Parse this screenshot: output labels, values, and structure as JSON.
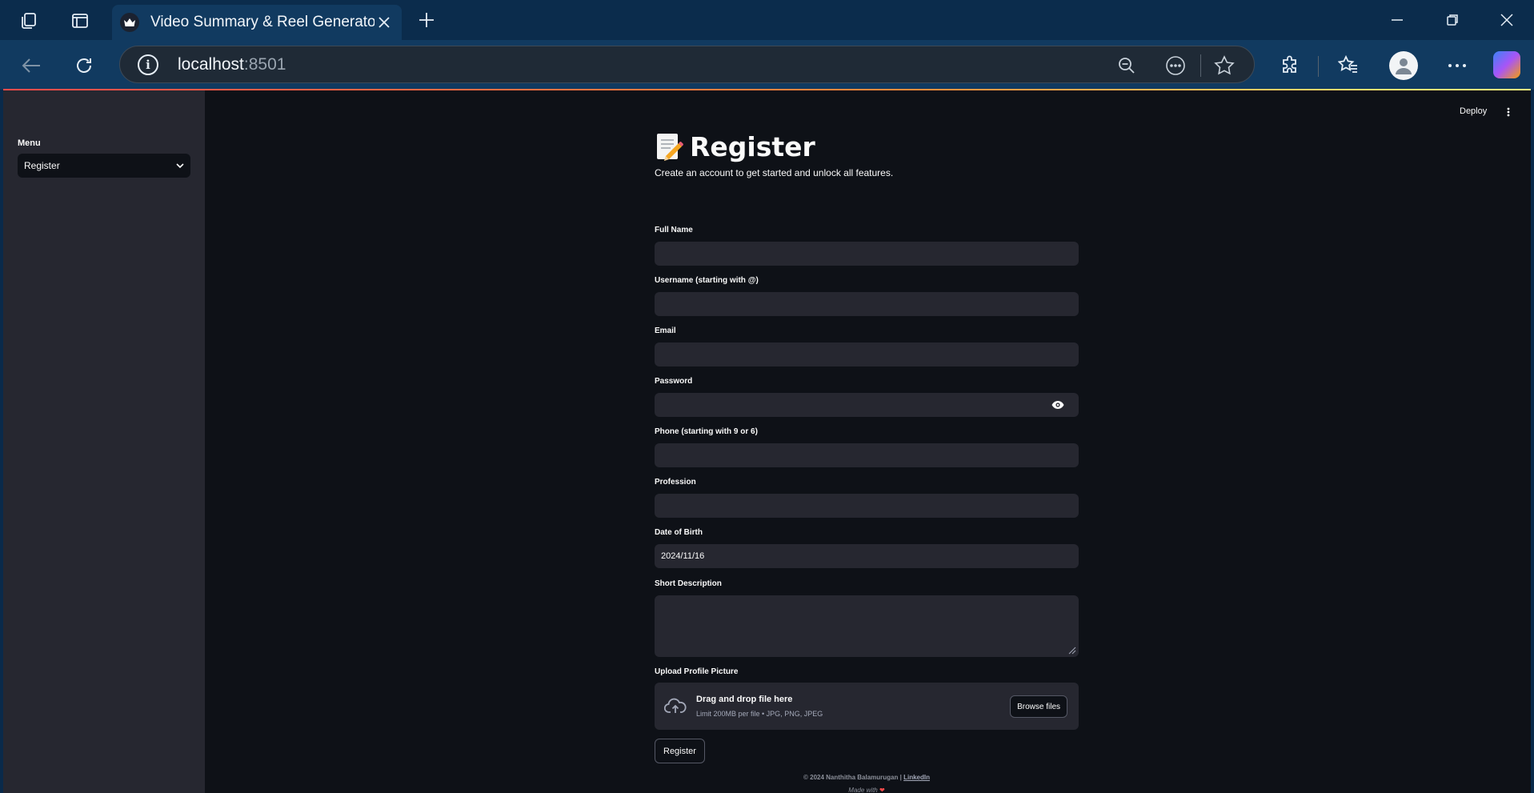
{
  "browser": {
    "tab_title": "Video Summary & Reel Generator",
    "url_host": "localhost",
    "url_port": ":8501"
  },
  "app": {
    "deploy_label": "Deploy",
    "sidebar": {
      "menu_label": "Menu",
      "menu_selected": "Register"
    },
    "title": "Register",
    "subtitle": "Create an account to get started and unlock all features.",
    "fields": {
      "full_name": {
        "label": "Full Name",
        "value": ""
      },
      "username": {
        "label": "Username (starting with @)",
        "value": ""
      },
      "email": {
        "label": "Email",
        "value": ""
      },
      "password": {
        "label": "Password",
        "value": ""
      },
      "phone": {
        "label": "Phone (starting with 9 or 6)",
        "value": ""
      },
      "profession": {
        "label": "Profession",
        "value": ""
      },
      "dob": {
        "label": "Date of Birth",
        "value": "2024/11/16"
      },
      "description": {
        "label": "Short Description",
        "value": ""
      },
      "upload": {
        "label": "Upload Profile Picture",
        "drop_text": "Drag and drop file here",
        "limit_text": "Limit 200MB per file • JPG, PNG, JPEG",
        "browse_label": "Browse files"
      }
    },
    "submit_label": "Register",
    "footer": {
      "copyright": "© 2024 Nanthitha Balamurugan |",
      "link": "LinkedIn",
      "made_with": "Made with"
    }
  }
}
